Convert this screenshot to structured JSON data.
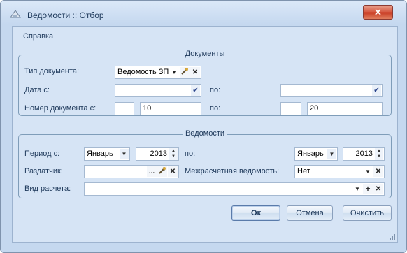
{
  "window": {
    "title": "Ведомости :: Отбор",
    "close_glyph": "✕"
  },
  "menu": {
    "spravka": "Справка"
  },
  "documents": {
    "title": "Документы",
    "doc_type_label": "Тип документа:",
    "doc_type_value": "Ведомость ЗП",
    "date_from_label": "Дата с:",
    "date_from_value": "",
    "date_to_label": "по:",
    "date_to_value": "",
    "docnum_label": "Номер документа  с:",
    "docnum_from_prefix": "",
    "docnum_from_value": "10",
    "docnum_to_label": "по:",
    "docnum_to_prefix": "",
    "docnum_to_value": "20"
  },
  "statements": {
    "title": "Ведомости",
    "period_label": "Период  с:",
    "period_from_month": "Январь",
    "period_from_year": "2013",
    "period_to_label": "по:",
    "period_to_month": "Январь",
    "period_to_year": "2013",
    "distributor_label": "Раздатчик:",
    "distributor_value": "",
    "intercalc_label": "Межрасчетная ведомость:",
    "intercalc_value": "Нет",
    "calc_type_label": "Вид расчета:",
    "calc_type_value": ""
  },
  "buttons": {
    "ok": "Ок",
    "cancel": "Отмена",
    "clear": "Очистить"
  },
  "glyphs": {
    "dropdown": "▼",
    "clear": "✕",
    "ellipsis": "...",
    "plus": "+",
    "up": "▲",
    "down": "▼",
    "check": "✔"
  },
  "icons": [
    "app-icon",
    "close-icon",
    "dropdown-icon",
    "pick-icon",
    "clear-icon",
    "ellipsis-icon",
    "add-icon",
    "spin-up-icon",
    "spin-down-icon",
    "resize-grip-icon"
  ]
}
